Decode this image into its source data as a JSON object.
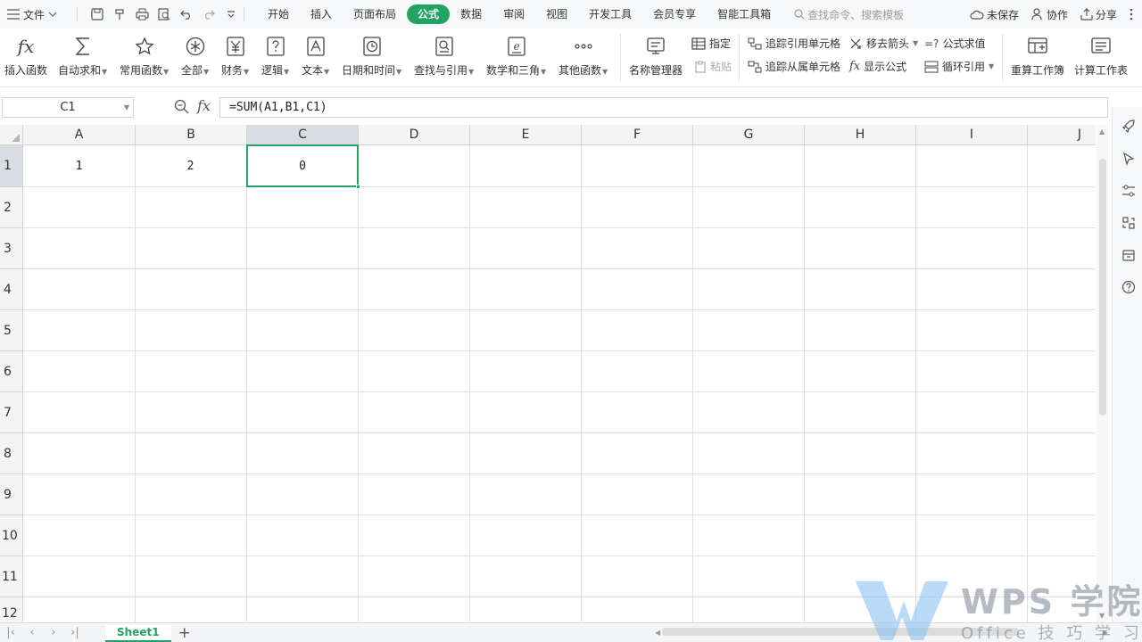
{
  "menubar": {
    "file_label": "文件",
    "tabs": [
      {
        "label": "开始"
      },
      {
        "label": "插入"
      },
      {
        "label": "页面布局"
      },
      {
        "label": "公式",
        "active": true
      },
      {
        "label": "数据"
      },
      {
        "label": "审阅"
      },
      {
        "label": "视图"
      },
      {
        "label": "开发工具"
      },
      {
        "label": "会员专享"
      },
      {
        "label": "智能工具箱"
      }
    ],
    "search_placeholder": "查找命令、搜索模板",
    "unsaved": "未保存",
    "collab": "协作",
    "share": "分享"
  },
  "ribbon": {
    "insert_function": "插入函数",
    "autosum": "自动求和",
    "common_functions": "常用函数",
    "all": "全部",
    "financial": "财务",
    "logical": "逻辑",
    "text": "文本",
    "datetime": "日期和时间",
    "lookup": "查找与引用",
    "math": "数学和三角",
    "other": "其他函数",
    "name_manager": "名称管理器",
    "specify": "指定",
    "paste": "粘贴",
    "trace_precedents": "追踪引用单元格",
    "trace_dependents": "追踪从属单元格",
    "remove_arrows": "移去箭头",
    "show_formulas": "显示公式",
    "evaluate_formula": "公式求值",
    "circular_ref": "循环引用",
    "recalc_workbook": "重算工作簿",
    "calc_sheet": "计算工作表",
    "fx_glyph": "fx",
    "evaluate_glyph": "=?"
  },
  "formula_bar": {
    "name_box": "C1",
    "fx_label": "fx",
    "formula": "=SUM(A1,B1,C1)"
  },
  "grid": {
    "columns": [
      "A",
      "B",
      "C",
      "D",
      "E",
      "F",
      "G",
      "H",
      "I",
      "J"
    ],
    "rows": [
      "1",
      "2",
      "3",
      "4",
      "5",
      "6",
      "7",
      "8",
      "9",
      "10",
      "11",
      "12"
    ],
    "cells": {
      "A1": "1",
      "B1": "2",
      "C1": "0"
    },
    "selected": "C1"
  },
  "sheets": {
    "tabs": [
      "Sheet1"
    ],
    "active": "Sheet1"
  },
  "watermark": {
    "title": "WPS 学院",
    "subtitle": "Office 技 巧 学 习 平 台"
  },
  "colors": {
    "accent": "#21a366"
  },
  "icons": [
    "menu-icon",
    "save-icon",
    "undo-icon",
    "redo-icon",
    "print-icon",
    "preview-icon",
    "cloud-icon",
    "user-icon",
    "share-icon",
    "more-icon",
    "search-icon",
    "zoom-icon",
    "rocket-icon",
    "cursor-icon",
    "sliders-icon",
    "transform-icon",
    "backup-icon",
    "help-icon"
  ]
}
